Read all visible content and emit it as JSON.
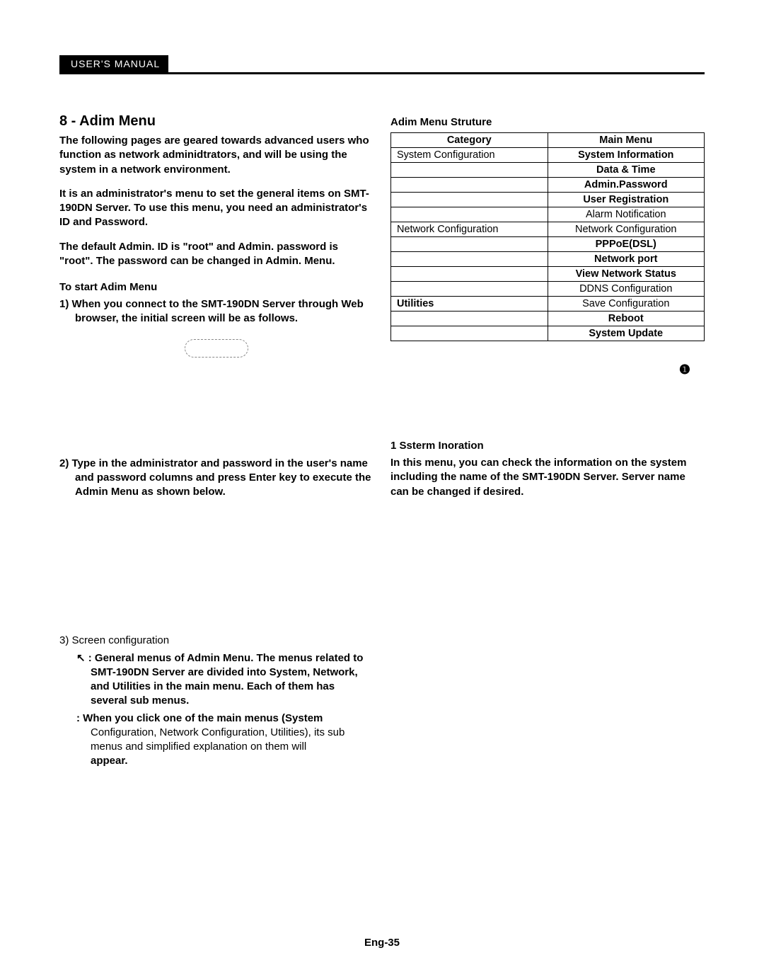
{
  "header": {
    "label": "USER'S MANUAL"
  },
  "left": {
    "title": "8 - Adim Menu",
    "para1": "The following pages are geared towards advanced users who function as network adminidtrators, and will be using the system in a network environment.",
    "para2": "It is an administrator's menu to set the general items on SMT-190DN Server. To use this menu, you need an administrator's ID and Password.",
    "para3": "The default Admin. ID is \"root\" and Admin. password is \"root\". The password can be changed in Admin. Menu.",
    "start_heading": "To start Adim Menu",
    "step1": "1) When you connect to the SMT-190DN Server through Web browser, the initial screen will be as follows.",
    "step2": "2)  Type in the administrator and password in the user's name and password columns and press Enter key to execute the Admin Menu as shown below.",
    "screencfg_title": "3) Screen configuration",
    "screencfg_a_lead": "↖ : General menus of Admin Menu. The menus related to SMT-190DN Server are divided into System, Network, and Utilities in the main menu. Each of them has several sub menus.",
    "screencfg_b_lead": ": When you click one of the main menus (System ",
    "screencfg_b_body1": "Configuration, Network Configuration, Utilities), its sub menus and simplified explanation on them will ",
    "screencfg_b_body2": "appear."
  },
  "right": {
    "struct_title": "Adim Menu Struture",
    "headers": {
      "cat": "Category",
      "main": "Main Menu"
    },
    "rows": [
      {
        "cat": "System Configuration",
        "cat_bold": false,
        "main": "System Information",
        "main_bold": true
      },
      {
        "cat": "",
        "cat_bold": false,
        "main": "Data & Time",
        "main_bold": true
      },
      {
        "cat": "",
        "cat_bold": false,
        "main": "Admin.Password",
        "main_bold": true
      },
      {
        "cat": "",
        "cat_bold": false,
        "main": "User Registration",
        "main_bold": true
      },
      {
        "cat": "",
        "cat_bold": false,
        "main": "Alarm Notification",
        "main_bold": false
      },
      {
        "cat": "Network Configuration",
        "cat_bold": false,
        "main": "Network Configuration",
        "main_bold": false
      },
      {
        "cat": "",
        "cat_bold": false,
        "main": "PPPoE(DSL)",
        "main_bold": true
      },
      {
        "cat": "",
        "cat_bold": false,
        "main": "Network port",
        "main_bold": true
      },
      {
        "cat": "",
        "cat_bold": false,
        "main": "View Network Status",
        "main_bold": true
      },
      {
        "cat": "",
        "cat_bold": false,
        "main": "DDNS Configuration",
        "main_bold": false
      },
      {
        "cat": "Utilities",
        "cat_bold": true,
        "main": "Save Configuration",
        "main_bold": false
      },
      {
        "cat": "",
        "cat_bold": false,
        "main": "Reboot",
        "main_bold": true
      },
      {
        "cat": "",
        "cat_bold": false,
        "main": "System Update",
        "main_bold": true
      }
    ],
    "info_icon": "❶",
    "sysinfo_num": "1 Ssterm Inoration",
    "sysinfo_body": "In this menu, you can check the information on the system including the name of the SMT-190DN Server. Server name can be changed if desired."
  },
  "footer": {
    "page": "Eng-35"
  }
}
